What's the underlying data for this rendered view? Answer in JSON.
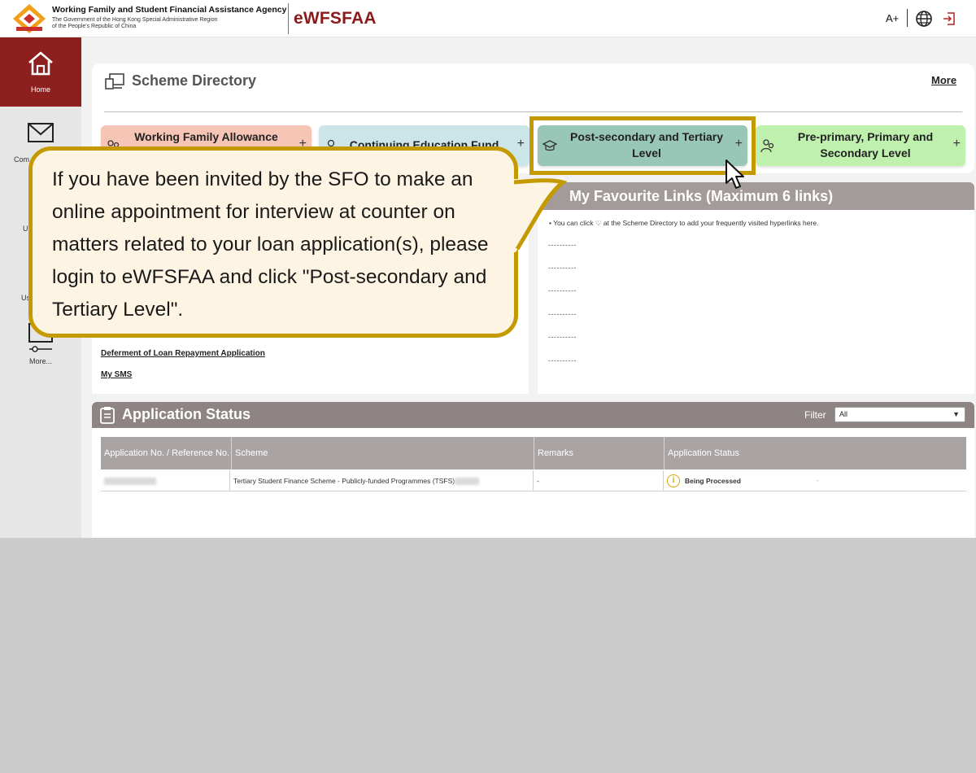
{
  "header": {
    "agency_name": "Working Family and Student Financial Assistance Agency",
    "agency_sub1": "The Government of the Hong Kong Special Administrative Region",
    "agency_sub2": "of the People's Republic of China",
    "app_name": "eWFSFAA",
    "font_size_button": "A+",
    "icons": [
      "logo-icon",
      "globe-icon",
      "logout-icon"
    ]
  },
  "sidebar": {
    "items": [
      {
        "label": "Home",
        "icon": "home-icon",
        "active": true
      },
      {
        "label": "Com",
        "icon": "mail-icon"
      },
      {
        "label": "U",
        "icon": "user-icon"
      },
      {
        "label": "Us",
        "icon": "user-settings-icon"
      },
      {
        "label": "More...",
        "icon": "more-icon"
      }
    ]
  },
  "scheme_directory": {
    "title": "Scheme Directory",
    "more_link": "More",
    "tiles": [
      {
        "label": "Working Family Allowance",
        "icon": "family-icon",
        "plus": "+"
      },
      {
        "label": "Continuing Education Fund",
        "icon": "person-icon",
        "plus": "+"
      },
      {
        "label": "Post-secondary and Tertiary Level",
        "icon": "graduation-cap-icon",
        "plus": "+"
      },
      {
        "label": "Pre-primary, Primary and Secondary Level",
        "icon": "students-icon",
        "plus": "+"
      }
    ]
  },
  "left_links": [
    "Deferment of Loan Repayment Application",
    "My SMS"
  ],
  "favourites": {
    "title": "My Favourite Links (Maximum 6 links)",
    "note": "You can click ♡ at the Scheme Directory to add your frequently visited hyperlinks here.",
    "placeholders": [
      "----------",
      "----------",
      "----------",
      "----------",
      "----------",
      "----------"
    ]
  },
  "application_status": {
    "title": "Application Status",
    "filter_label": "Filter",
    "filter_value": "All",
    "columns": [
      "Application No. / Reference No.",
      "Scheme",
      "Remarks",
      "Application Status"
    ],
    "rows": [
      {
        "scheme": "Tertiary Student Finance Scheme - Publicly-funded Programmes (TSFS)",
        "remarks": "-",
        "status": "Being Processed",
        "extra": "-"
      }
    ]
  },
  "callout": {
    "text": "If you have been invited by the SFO to make an online appointment for interview at counter on matters related to your loan application(s), please login to eWFSFAA and click \"Post-secondary and Tertiary Level\"."
  },
  "colors": {
    "brand": "#8e1f1f",
    "highlight": "#c49a00",
    "tile_wfa": "#f6c5b5",
    "tile_cef": "#cbe5e8",
    "tile_pst": "#99c7b7",
    "tile_ppp": "#bff0ae",
    "status_header": "#8f8484"
  }
}
